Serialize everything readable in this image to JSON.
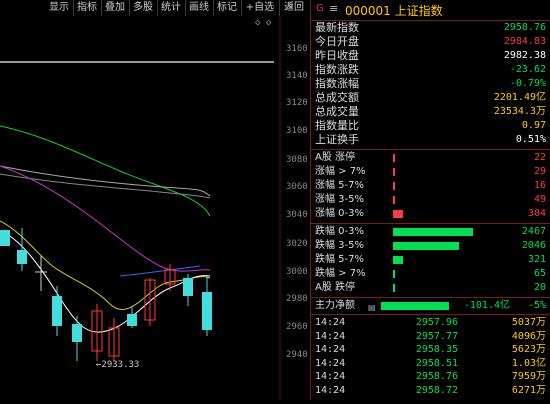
{
  "toolbar": {
    "buttons": [
      "显示",
      "指标",
      "叠加",
      "多股",
      "统计",
      "画线",
      "标记",
      "+自选",
      "返回"
    ]
  },
  "chart": {
    "price_labels": [
      "3160",
      "3140",
      "3120",
      "3100",
      "3080",
      "3060",
      "3040",
      "3020",
      "3000",
      "2980",
      "2960",
      "2940"
    ],
    "low_marker": "←2933.33",
    "corner_icons": "◇ ◇",
    "top_partial": "6"
  },
  "header": {
    "g_mark": "G",
    "menu_icon": "≡",
    "title": "000001 上证指数"
  },
  "stats": [
    {
      "label": "最新指数",
      "value": "2958.76",
      "color": "#00e050"
    },
    {
      "label": "今日开盘",
      "value": "2984.83",
      "color": "#ff3b3b"
    },
    {
      "label": "昨日收盘",
      "value": "2982.38",
      "color": "#ffffff"
    },
    {
      "label": "指数涨跌",
      "value": "-23.62",
      "color": "#00e050"
    },
    {
      "label": "指数涨幅",
      "value": "-0.79%",
      "color": "#00e050"
    },
    {
      "label": "总成交额",
      "value": "2201.49亿",
      "color": "#ffcc00"
    },
    {
      "label": "总成交量",
      "value": "23534.3万",
      "color": "#ffcc00"
    },
    {
      "label": "指数量比",
      "value": "0.97",
      "color": "#ffcc00"
    },
    {
      "label": "上证换手",
      "value": "0.51%",
      "color": "#ffffff"
    }
  ],
  "rise_bars": [
    {
      "label": "A股 涨停",
      "value": "22",
      "fraction": 0.01
    },
    {
      "label": "涨幅 > 7%",
      "value": "29",
      "fraction": 0.01
    },
    {
      "label": "涨幅 5-7%",
      "value": "16",
      "fraction": 0.01
    },
    {
      "label": "涨幅 3-5%",
      "value": "49",
      "fraction": 0.02
    },
    {
      "label": "涨幅 0-3%",
      "value": "304",
      "fraction": 0.12
    }
  ],
  "fall_bars": [
    {
      "label": "跌幅 0-3%",
      "value": "2467",
      "fraction": 1.0
    },
    {
      "label": "跌幅 3-5%",
      "value": "2046",
      "fraction": 0.83
    },
    {
      "label": "跌幅 5-7%",
      "value": "321",
      "fraction": 0.13
    },
    {
      "label": "跌幅 > 7%",
      "value": "65",
      "fraction": 0.03
    },
    {
      "label": "A股 跌停",
      "value": "20",
      "fraction": 0.01
    }
  ],
  "net_flow": {
    "label": "主力净额",
    "value": "-101.4亿",
    "pct": "-5%"
  },
  "ticks": [
    {
      "time": "14:24",
      "price": "2957.96",
      "vol": "5037万"
    },
    {
      "time": "14:24",
      "price": "2957.77",
      "vol": "4096万"
    },
    {
      "time": "14:24",
      "price": "2958.35",
      "vol": "5623万"
    },
    {
      "time": "14:24",
      "price": "2958.51",
      "vol": "1.03亿"
    },
    {
      "time": "14:24",
      "price": "2958.76",
      "vol": "7959万"
    },
    {
      "time": "14:24",
      "price": "2958.72",
      "vol": "6271万"
    }
  ],
  "colors": {
    "up": "#ff3b3b",
    "down": "#00e050",
    "accent": "#ffcc00",
    "border": "#7a1a1a"
  }
}
